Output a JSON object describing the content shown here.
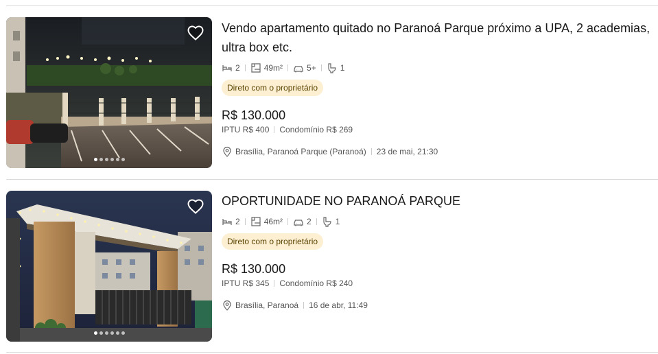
{
  "listings": [
    {
      "title": "Vendo apartamento quitado no Paranoá Parque próximo a UPA, 2 academias, ultra box etc.",
      "bedrooms": "2",
      "area": "49m²",
      "parking": "5+",
      "bathrooms": "1",
      "badge": "Direto com o proprietário",
      "price": "R$ 130.000",
      "iptu": "IPTU R$ 400",
      "condo": "Condomínio R$ 269",
      "location": "Brasília, Paranoá Parque (Paranoá)",
      "date": "23 de mai, 21:30",
      "photo_count": 6,
      "active_photo": 1
    },
    {
      "title": "OPORTUNIDADE NO PARANOÁ PARQUE",
      "bedrooms": "2",
      "area": "46m²",
      "parking": "2",
      "bathrooms": "1",
      "badge": "Direto com o proprietário",
      "price": "R$ 130.000",
      "iptu": "IPTU R$ 345",
      "condo": "Condomínio R$ 240",
      "location": "Brasília, Paranoá",
      "date": "16 de abr, 11:49",
      "photo_count": 6,
      "active_photo": 1
    }
  ],
  "icons": {
    "favorite": "heart-icon",
    "bedrooms": "bed-icon",
    "area": "area-icon",
    "parking": "car-icon",
    "bathrooms": "toilet-icon",
    "location": "map-pin-icon"
  },
  "colors": {
    "badge_bg": "#fcefd2",
    "badge_text": "#5b4300",
    "text": "#1a1a1a",
    "muted": "#555555",
    "divider": "#dadada"
  }
}
